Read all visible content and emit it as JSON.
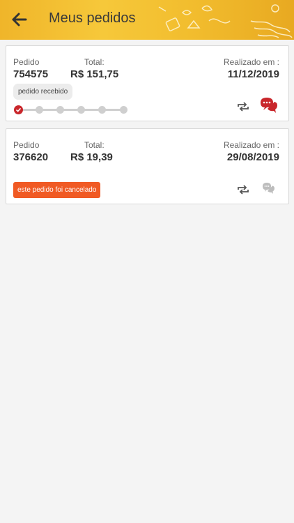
{
  "header": {
    "title": "Meus pedidos",
    "back_icon": "arrow-left-icon",
    "background_color": "#f2bd2e"
  },
  "orders": [
    {
      "order_label": "Pedido",
      "order_number": "754575",
      "total_label": "Total:",
      "total_value": "R$ 151,75",
      "date_label": "Realizado em :",
      "date_value": "11/12/2019",
      "status_text": "pedido recebido",
      "progress": {
        "completed_steps": 1,
        "total_steps": 6
      },
      "repeat_icon": "repeat-icon",
      "chat_icon": "chat-bubble-icon",
      "chat_color": "#c9262b"
    },
    {
      "order_label": "Pedido",
      "order_number": "376620",
      "total_label": "Total:",
      "total_value": "R$ 19,39",
      "date_label": "Realizado em :",
      "date_value": "29/08/2019",
      "status_text": "este pedido foi cancelado",
      "status_color": "#f05a24",
      "repeat_icon": "repeat-icon",
      "chat_icon": "chat-bubble-icon",
      "chat_color": "#bdbdbd"
    }
  ]
}
